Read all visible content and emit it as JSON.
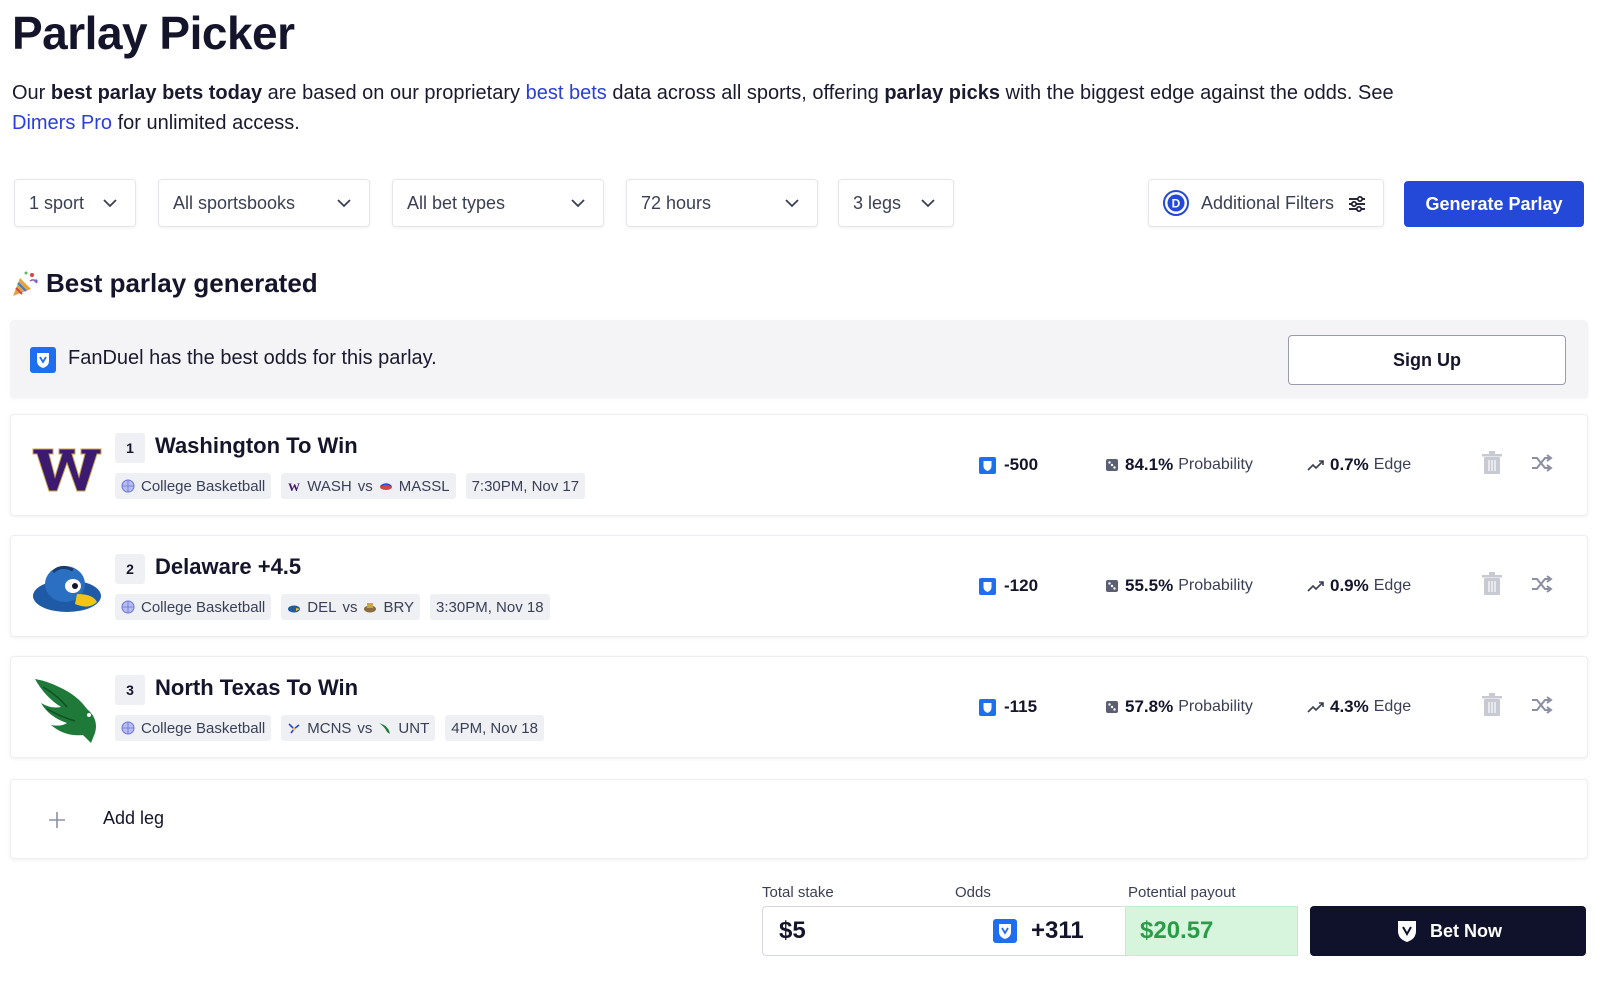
{
  "page": {
    "title": "Parlay Picker",
    "intro": {
      "p1": "Our ",
      "b1": "best parlay bets today",
      "p2": " are based on our proprietary ",
      "link1": "best bets",
      "p3": " data across all sports, offering ",
      "b2": "parlay picks",
      "p4": " with the biggest edge against the odds. See ",
      "link2": "Dimers Pro",
      "p5": " for unlimited access."
    }
  },
  "filters": {
    "sport": "1 sport",
    "sportsbooks": "All sportsbooks",
    "bet_types": "All bet types",
    "time": "72 hours",
    "legs": "3 legs",
    "additional": "Additional Filters",
    "generate": "Generate Parlay"
  },
  "result": {
    "heading": "Best parlay generated",
    "banner_msg": "FanDuel has the best odds for this parlay.",
    "signup": "Sign Up"
  },
  "legs": [
    {
      "num": "1",
      "name": "Washington To Win",
      "league": "College Basketball",
      "team1": "WASH",
      "vs": "vs",
      "team2": "MASSL",
      "time": "7:30PM, Nov 17",
      "odds": "-500",
      "prob": "84.1%",
      "prob_label": "Probability",
      "edge": "0.7%",
      "edge_label": "Edge"
    },
    {
      "num": "2",
      "name": "Delaware +4.5",
      "league": "College Basketball",
      "team1": "DEL",
      "vs": "vs",
      "team2": "BRY",
      "time": "3:30PM, Nov 18",
      "odds": "-120",
      "prob": "55.5%",
      "prob_label": "Probability",
      "edge": "0.9%",
      "edge_label": "Edge"
    },
    {
      "num": "3",
      "name": "North Texas To Win",
      "league": "College Basketball",
      "team1": "MCNS",
      "vs": "vs",
      "team2": "UNT",
      "time": "4PM, Nov 18",
      "odds": "-115",
      "prob": "57.8%",
      "prob_label": "Probability",
      "edge": "4.3%",
      "edge_label": "Edge"
    }
  ],
  "add_leg": "Add leg",
  "bet_slip": {
    "stake_label": "Total stake",
    "stake": "$5",
    "odds_label": "Odds",
    "odds": "+311",
    "payout_label": "Potential payout",
    "payout": "$20.57",
    "bet_now": "Bet Now"
  },
  "colors": {
    "primary": "#2449d8",
    "fanduel": "#1e6ff0",
    "payout_bg": "#d6f5dc",
    "payout_text": "#2c9b49",
    "dark": "#10112a",
    "washington": "#3b1a6f",
    "unt_green": "#1f7a3a"
  },
  "icons": [
    "chevron-down-icon",
    "dimers-logo-icon",
    "sliders-icon",
    "party-popper-icon",
    "fanduel-shield-icon",
    "basketball-icon",
    "dice-icon",
    "trend-up-icon",
    "trash-icon",
    "shuffle-icon",
    "plus-icon"
  ]
}
